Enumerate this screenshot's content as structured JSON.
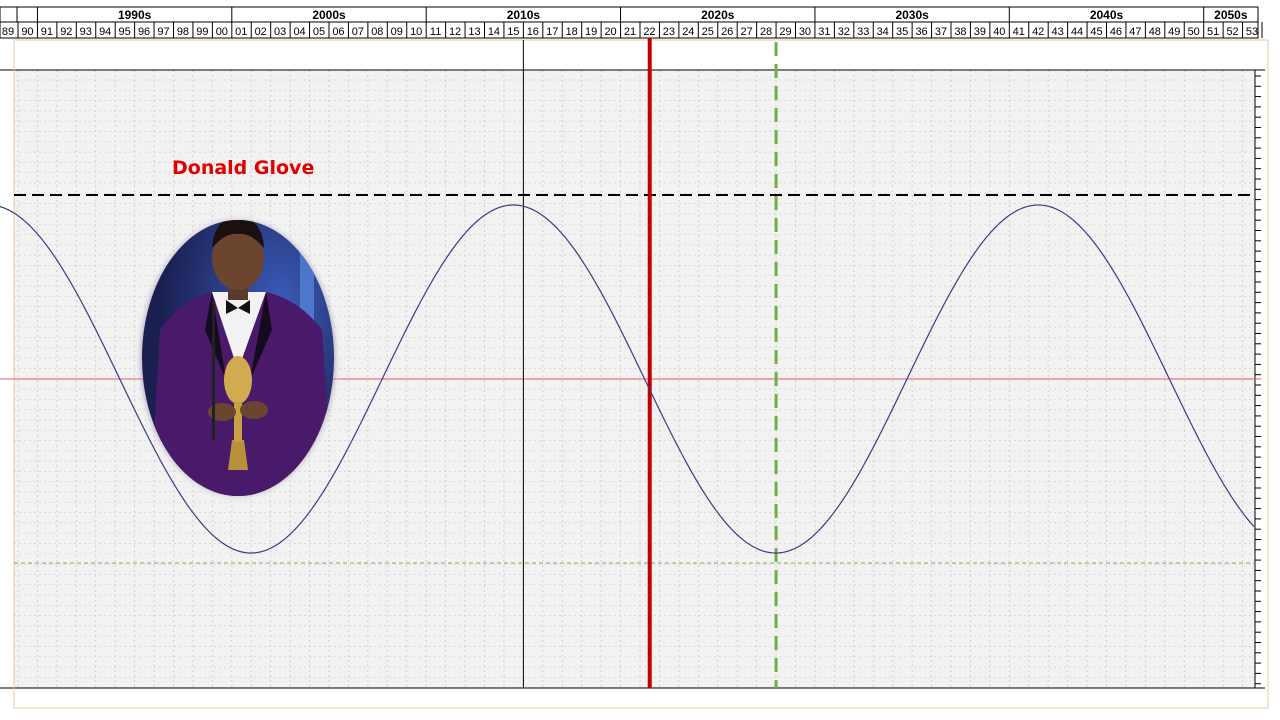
{
  "chart_data": {
    "type": "line",
    "title": "",
    "xlabel": "",
    "ylabel": "",
    "x_unit": "year",
    "xlim": [
      1989,
      2053
    ],
    "decades": [
      "1990s",
      "2000s",
      "2010s",
      "2020s",
      "2030s",
      "2040s",
      "2050s"
    ],
    "year_labels": [
      "89",
      "90",
      "91",
      "92",
      "93",
      "94",
      "95",
      "96",
      "97",
      "98",
      "99",
      "00",
      "01",
      "02",
      "03",
      "04",
      "05",
      "06",
      "07",
      "08",
      "09",
      "10",
      "11",
      "12",
      "13",
      "14",
      "15",
      "16",
      "17",
      "18",
      "19",
      "20",
      "21",
      "22",
      "23",
      "24",
      "25",
      "26",
      "27",
      "28",
      "29",
      "30",
      "31",
      "32",
      "33",
      "34",
      "35",
      "36",
      "37",
      "38",
      "39",
      "40",
      "41",
      "42",
      "43",
      "44",
      "45",
      "46",
      "47",
      "48",
      "49",
      "50",
      "51",
      "52",
      "53"
    ],
    "series": [
      {
        "color": "#3c3c82",
        "shape": "cosine",
        "x": [
          1989,
          1990,
          2001,
          2015,
          2028,
          2042,
          2053
        ],
        "y": [
          0.8,
          0.87,
          -0.87,
          0.87,
          -0.87,
          0.87,
          -0.76
        ]
      }
    ],
    "ylim": [
      -1.0,
      1.0
    ],
    "reference_lines": {
      "zero_line_color": "#e06060",
      "upper_dashed_y": 0.92,
      "upper_dashed_color": "#000000",
      "lower_dashed_y": -0.92,
      "lower_dashed_color": "#7ab060",
      "current_year": 2021.5,
      "current_year_color": "#c00000",
      "marker_year": 2028,
      "marker_color": "#70ad47",
      "thin_vertical_year": 2015
    },
    "grid": true
  },
  "annotation": {
    "name": "Donald Glove",
    "name_color": "#e00000"
  }
}
